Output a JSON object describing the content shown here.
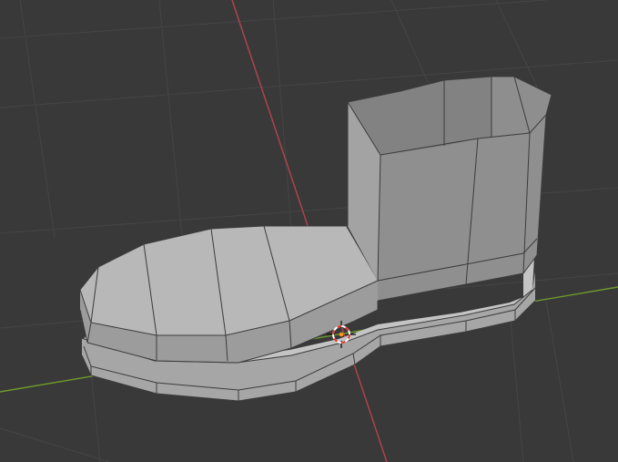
{
  "app": "3d-viewport",
  "scene": {
    "object": "boot-mesh",
    "mode": "object",
    "cursor_visible": true,
    "axes_visible": [
      "x",
      "y"
    ]
  },
  "colors": {
    "background": "#393939",
    "grid_line": "#454545",
    "axis_x": "#b5434f",
    "axis_y": "#6e9a2c",
    "mesh_light": "#b3b3b3",
    "mesh_mid": "#9a9a9a",
    "mesh_dark": "#7b7b7b",
    "edge": "#3c3c3c",
    "cursor_ring_red": "#e23a2a",
    "cursor_ring_white": "#ffffff"
  }
}
